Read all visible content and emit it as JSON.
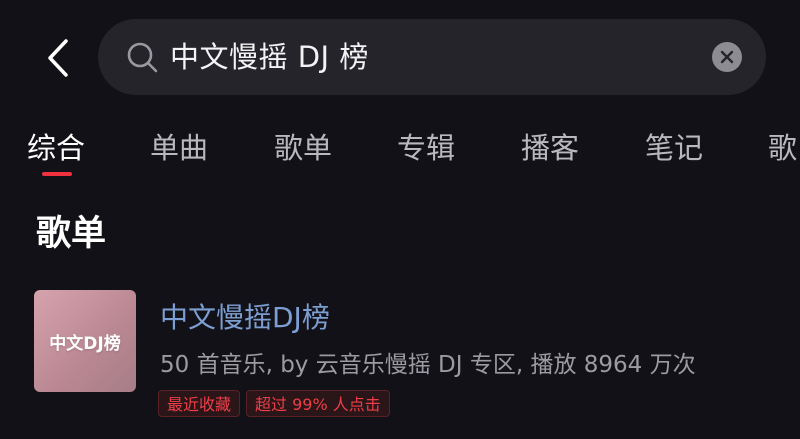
{
  "header": {
    "back_icon": "chevron-left-icon",
    "search": {
      "value": "中文慢摇 DJ 榜",
      "search_icon": "search-icon",
      "clear_icon": "close-icon"
    }
  },
  "tabs": [
    {
      "label": "综合",
      "active": true
    },
    {
      "label": "单曲",
      "active": false
    },
    {
      "label": "歌单",
      "active": false
    },
    {
      "label": "专辑",
      "active": false
    },
    {
      "label": "播客",
      "active": false
    },
    {
      "label": "笔记",
      "active": false
    },
    {
      "label": "歌",
      "active": false
    }
  ],
  "section": {
    "title": "歌单"
  },
  "playlist": {
    "cover_text": "中文DJ榜",
    "title": "中文慢摇DJ榜",
    "meta": "50 首音乐, by 云音乐慢摇 DJ 专区, 播放 8964 万次",
    "badges": [
      "最近收藏",
      "超过 99% 人点击"
    ]
  },
  "colors": {
    "background": "#121117",
    "search_bg": "#25242b",
    "accent_red": "#f0313f",
    "title_blue": "#7d9ed3",
    "meta_gray": "#9c9ba2"
  }
}
